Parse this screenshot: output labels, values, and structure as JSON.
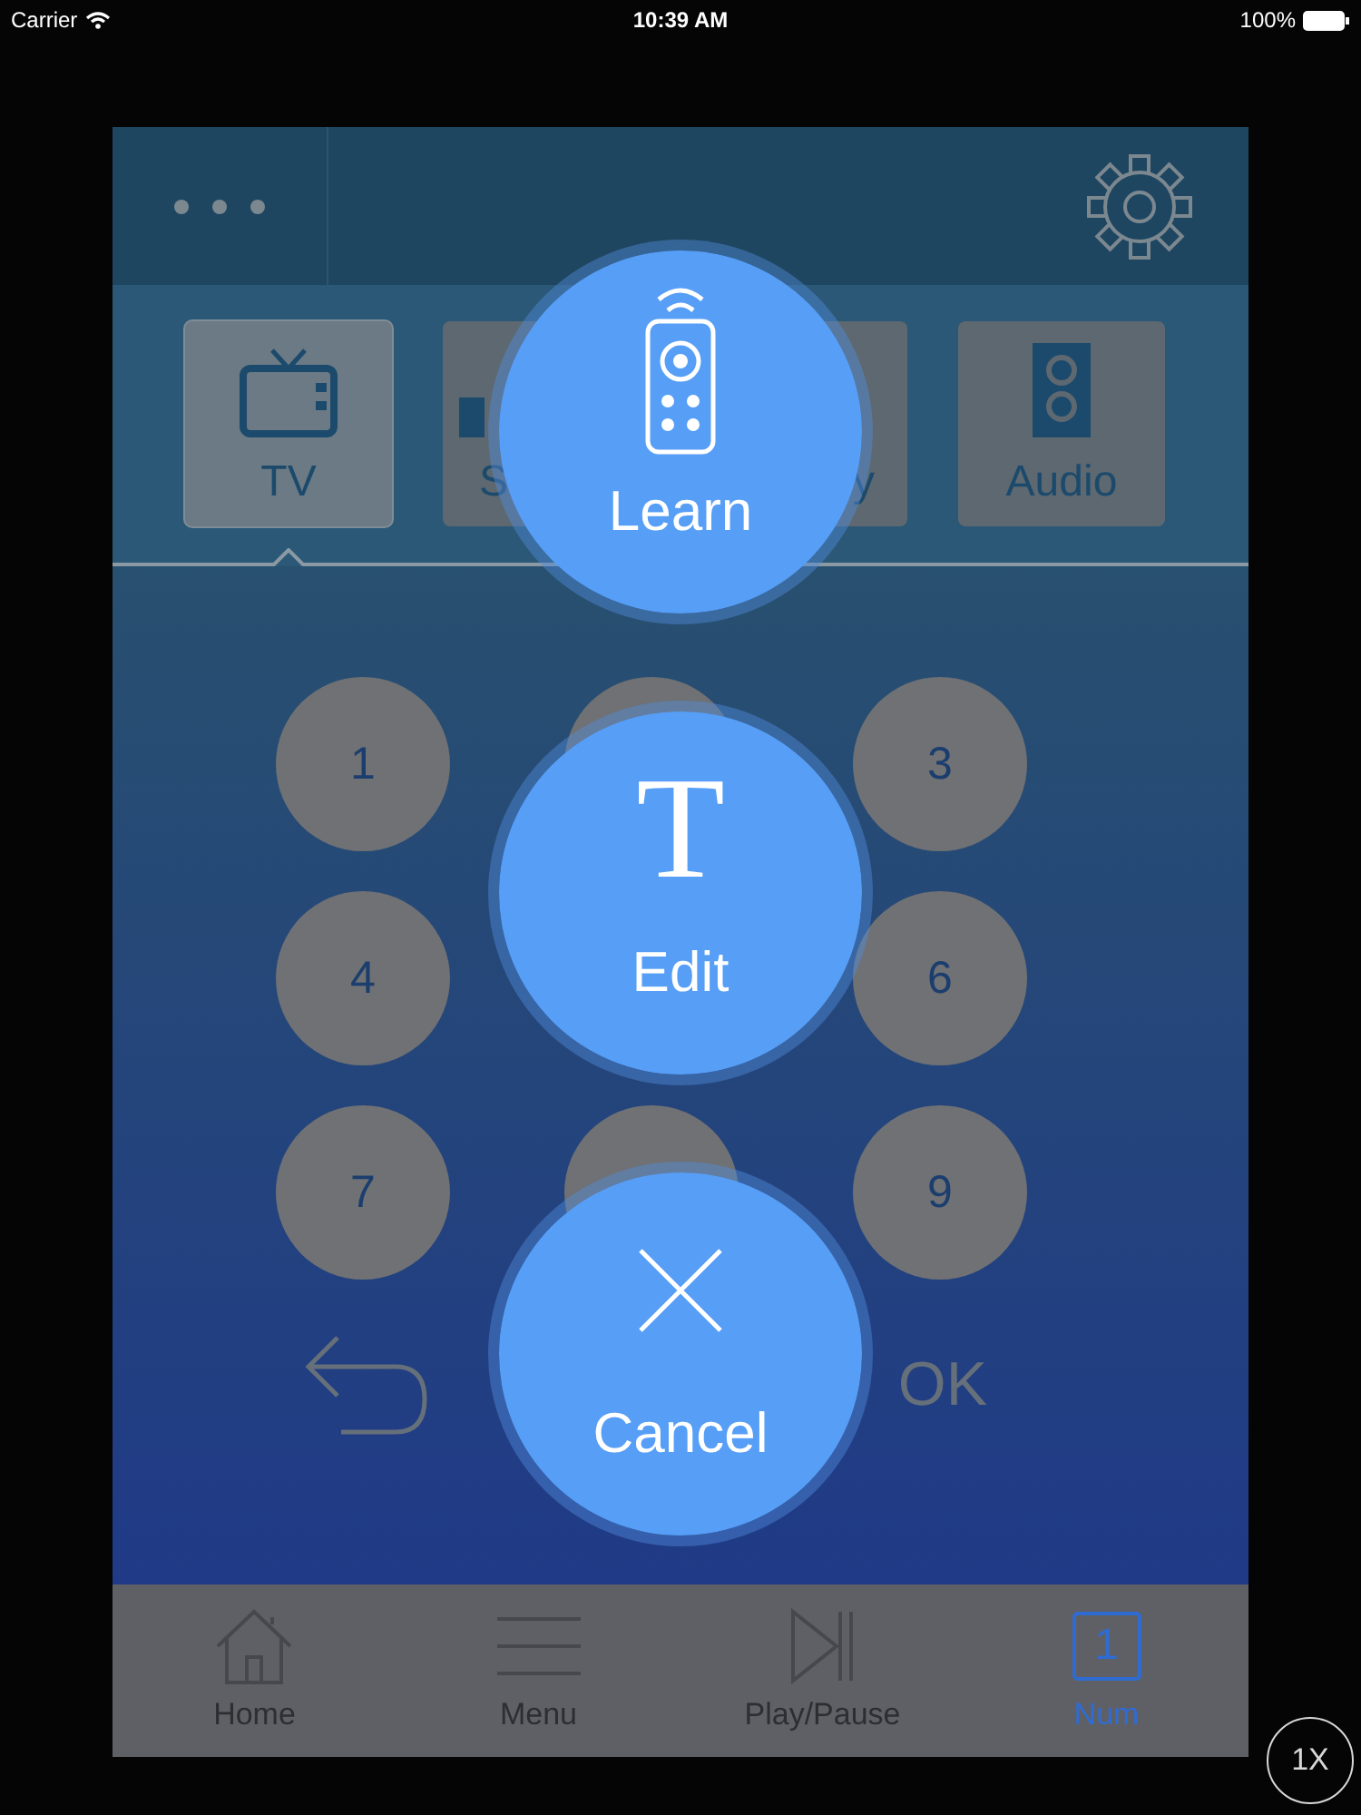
{
  "status_bar": {
    "carrier": "Carrier",
    "time": "10:39 AM",
    "battery": "100%"
  },
  "categories": [
    {
      "label": "TV",
      "kind": "tv",
      "selected": true
    },
    {
      "label": "S",
      "kind": "cut_start",
      "selected": false
    },
    {
      "label": "y",
      "kind": "cut_end",
      "selected": false
    },
    {
      "label": "Audio",
      "kind": "audio",
      "selected": false
    }
  ],
  "keypad": [
    {
      "kind": "key",
      "label": "1"
    },
    {
      "kind": "key"
    },
    {
      "kind": "key",
      "label": "3"
    },
    {
      "kind": "key",
      "label": "4"
    },
    {
      "kind": "gap"
    },
    {
      "kind": "key",
      "label": "6"
    },
    {
      "kind": "key",
      "label": "7"
    },
    {
      "kind": "key"
    },
    {
      "kind": "key",
      "label": "9"
    }
  ],
  "ok_label": "OK",
  "bottom_tabs": [
    {
      "label": "Home",
      "kind": "home",
      "selected": false
    },
    {
      "label": "Menu",
      "kind": "menu",
      "selected": false
    },
    {
      "label": "Play/Pause",
      "kind": "playpause",
      "selected": false
    },
    {
      "label": "Num",
      "kind": "num",
      "icon_text": "1",
      "selected": true
    }
  ],
  "actions": [
    {
      "label": "Learn",
      "kind": "learn"
    },
    {
      "label": "Edit",
      "kind": "edit",
      "icon_text": "T"
    },
    {
      "label": "Cancel",
      "kind": "cancel"
    }
  ],
  "zoom_button": "1X"
}
